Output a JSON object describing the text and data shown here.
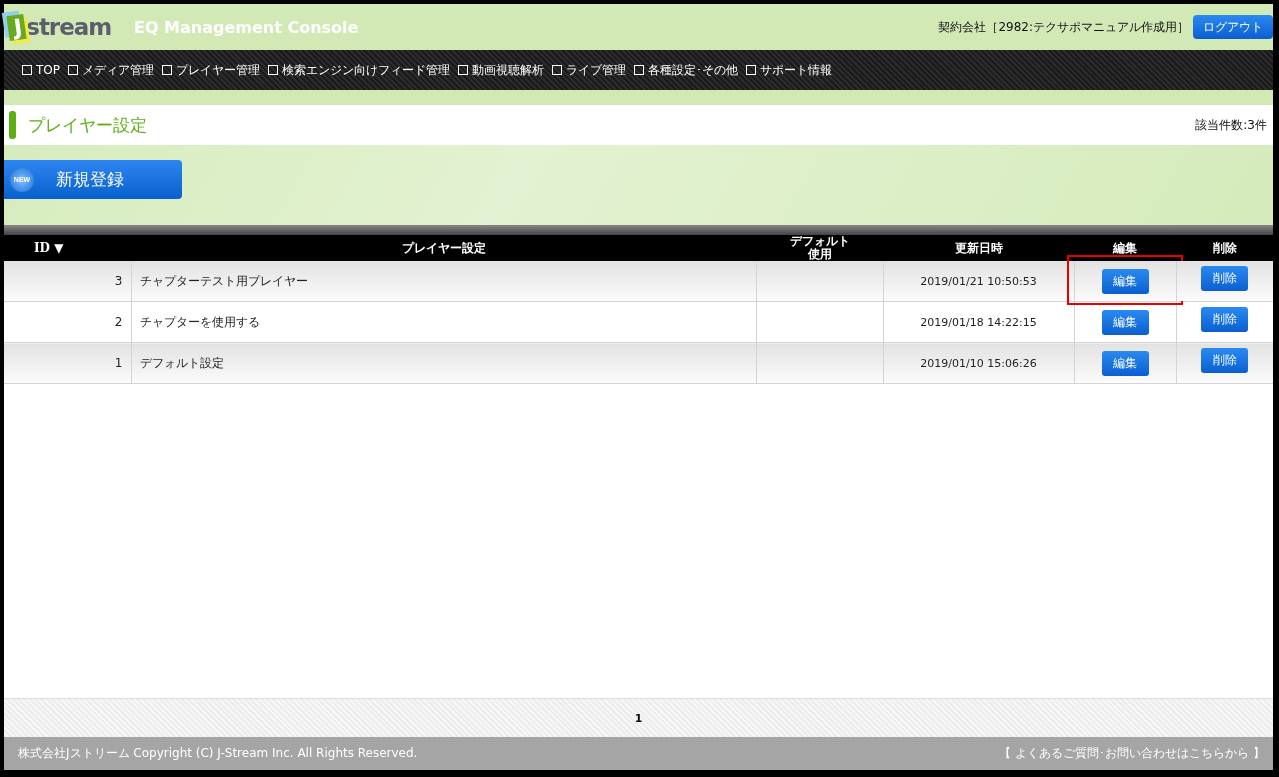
{
  "header": {
    "logo_mark": "J",
    "logo_text": "stream",
    "app_title": "EQ Management Console",
    "account": "契約会社［2982:テクサポマニュアル作成用］",
    "logout": "ログアウト"
  },
  "nav": [
    {
      "label": "TOP"
    },
    {
      "label": "メディア管理"
    },
    {
      "label": "プレイヤー管理"
    },
    {
      "label": "検索エンジン向けフィード管理"
    },
    {
      "label": "動画視聴解析"
    },
    {
      "label": "ライブ管理"
    },
    {
      "label": "各種設定･その他"
    },
    {
      "label": "サポート情報"
    }
  ],
  "page": {
    "title": "プレイヤー設定",
    "count": "該当件数:3件",
    "new_badge": "NEW",
    "new_button": "新規登録"
  },
  "table": {
    "columns": [
      {
        "lines": [
          "ID ▼"
        ]
      },
      {
        "lines": [
          "プレイヤー設定"
        ]
      },
      {
        "lines": [
          "デフォルト",
          "使用"
        ]
      },
      {
        "lines": [
          "更新日時"
        ]
      },
      {
        "lines": [
          "編集"
        ]
      },
      {
        "lines": [
          "削除"
        ]
      }
    ],
    "rows": [
      {
        "id": "3",
        "name": "チャプターテスト用プレイヤー",
        "updated": "2019/01/21 10:50:53",
        "edit": "編集",
        "delete": "削除",
        "highlighted": true
      },
      {
        "id": "2",
        "name": "チャプターを使用する",
        "updated": "2019/01/18 14:22:15",
        "edit": "編集",
        "delete": "削除",
        "highlighted": false
      },
      {
        "id": "1",
        "name": "デフォルト設定",
        "updated": "2019/01/10 15:06:26",
        "edit": "編集",
        "delete": "削除",
        "highlighted": false
      }
    ]
  },
  "pagination": {
    "pages": [
      {
        "label": "1",
        "selected": true
      }
    ]
  },
  "footer": {
    "copyright": "株式会社Jストリーム  Copyright (C) J-Stream Inc. All Rights Reserved.",
    "contact": "【 よくあるご質問･お問い合わせはこちらから 】"
  }
}
